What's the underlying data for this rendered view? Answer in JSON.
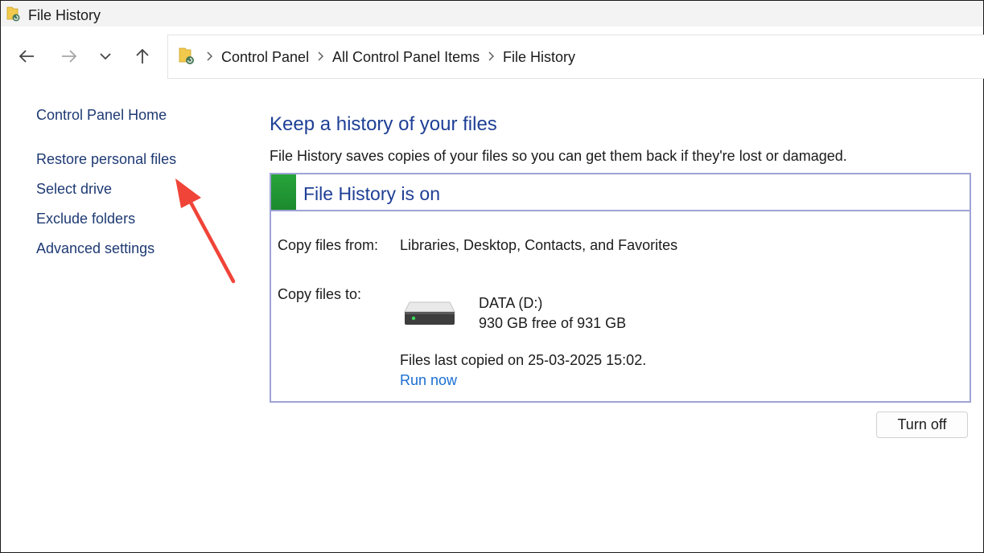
{
  "window": {
    "title": "File History",
    "icon": "file-history-folder-icon"
  },
  "nav": {
    "back_icon": "arrow-left-icon",
    "forward_icon": "arrow-right-icon",
    "recent_icon": "chevron-down-icon",
    "up_icon": "arrow-up-icon"
  },
  "breadcrumb": [
    "Control Panel",
    "All Control Panel Items",
    "File History"
  ],
  "sidebar": {
    "home": "Control Panel Home",
    "items": [
      "Restore personal files",
      "Select drive",
      "Exclude folders",
      "Advanced settings"
    ]
  },
  "main": {
    "heading": "Keep a history of your files",
    "description": "File History saves copies of your files so you can get them back if they're lost or damaged.",
    "status": "File History is on",
    "status_color": "#27a43b",
    "copy_from_label": "Copy files from:",
    "copy_from_value": "Libraries, Desktop, Contacts, and Favorites",
    "copy_to_label": "Copy files to:",
    "drive_name": "DATA (D:)",
    "drive_space": "930 GB free of 931 GB",
    "last_copied": "Files last copied on 25-03-2025 15:02.",
    "run_now": "Run now",
    "turn_off": "Turn off"
  },
  "annotation": {
    "arrow_color": "#f04438"
  }
}
